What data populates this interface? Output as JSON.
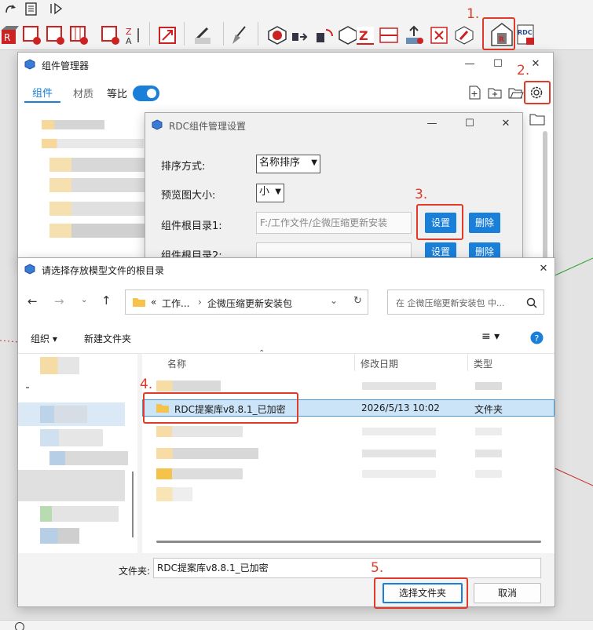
{
  "annotations": [
    "1.",
    "2.",
    "3.",
    "4.",
    "5."
  ],
  "component_manager": {
    "title": "组件管理器",
    "tabs": [
      "组件",
      "材质"
    ],
    "toggle_label": "等比",
    "toggle_on": true
  },
  "settings_dialog": {
    "title": "RDC组件管理设置",
    "sort_label": "排序方式:",
    "sort_value": "名称排序",
    "preview_label": "预览图大小:",
    "preview_value": "小",
    "root1_label": "组件根目录1:",
    "root1_value": "F:/工作文件/企微压缩更新安装",
    "root2_label": "组件根目录2:",
    "set_button": "设置",
    "delete_button": "删除"
  },
  "folder_dialog": {
    "title": "请选择存放模型文件的根目录",
    "breadcrumb": [
      "«",
      "工作...",
      "企微压缩更新安装包"
    ],
    "search_placeholder": "在 企微压缩更新安装包 中...",
    "organize": "组织",
    "new_folder": "新建文件夹",
    "columns": [
      "名称",
      "修改日期",
      "类型"
    ],
    "selected_row": {
      "name": "RDC提案库v8.8.1_已加密",
      "date": "2026/5/13 10:02",
      "type": "文件夹"
    },
    "folder_label": "文件夹:",
    "folder_value": "RDC提案库v8.8.1_已加密",
    "select_button": "选择文件夹",
    "cancel_button": "取消"
  },
  "colors": {
    "accent": "#1a7fd8",
    "annotation": "#e13a2a",
    "selection": "#cce4f7",
    "folder": "#f5c24a"
  }
}
